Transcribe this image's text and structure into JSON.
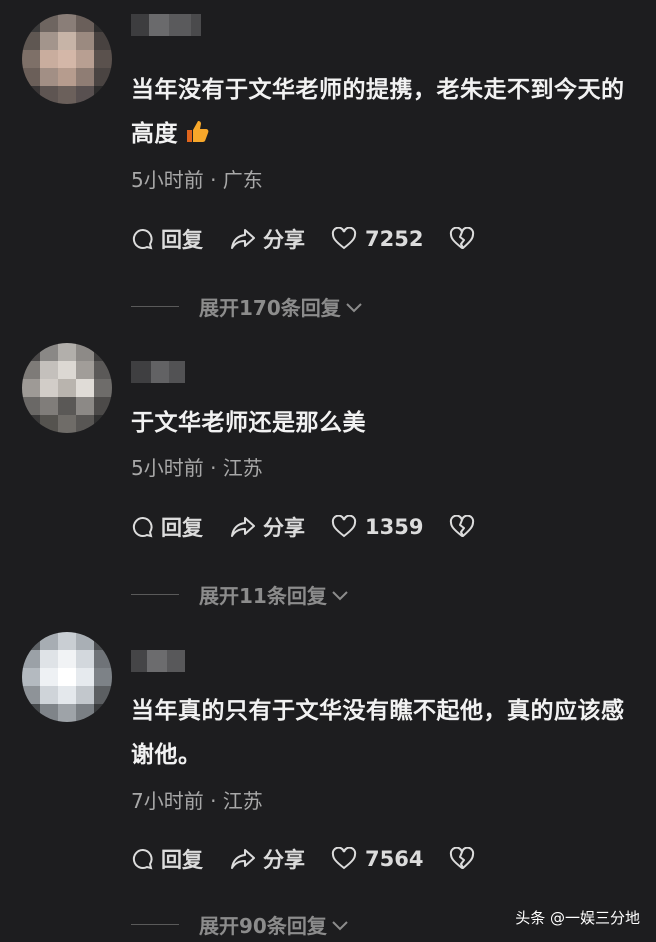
{
  "comments": [
    {
      "text": "当年没有于文华老师的提携，老朱走不到今天的高度",
      "emoji_icon": "thumbs-up-icon",
      "meta": "5小时前 · 广东",
      "reply_label": "回复",
      "share_label": "分享",
      "likes": "7252",
      "expand_label": "展开170条回复"
    },
    {
      "text": "于文华老师还是那么美",
      "meta": "5小时前 · 江苏",
      "reply_label": "回复",
      "share_label": "分享",
      "likes": "1359",
      "expand_label": "展开11条回复"
    },
    {
      "text": "当年真的只有于文华没有瞧不起他，真的应该感谢他。",
      "meta": "7小时前 · 江苏",
      "reply_label": "回复",
      "share_label": "分享",
      "likes": "7564",
      "expand_label": "展开90条回复"
    }
  ],
  "watermark": "头条 @一娱三分地",
  "colors": {
    "background": "#1d1d1f",
    "text": "#f2f2f2",
    "meta": "#a8a8a8",
    "muted": "#8c8c8c"
  }
}
